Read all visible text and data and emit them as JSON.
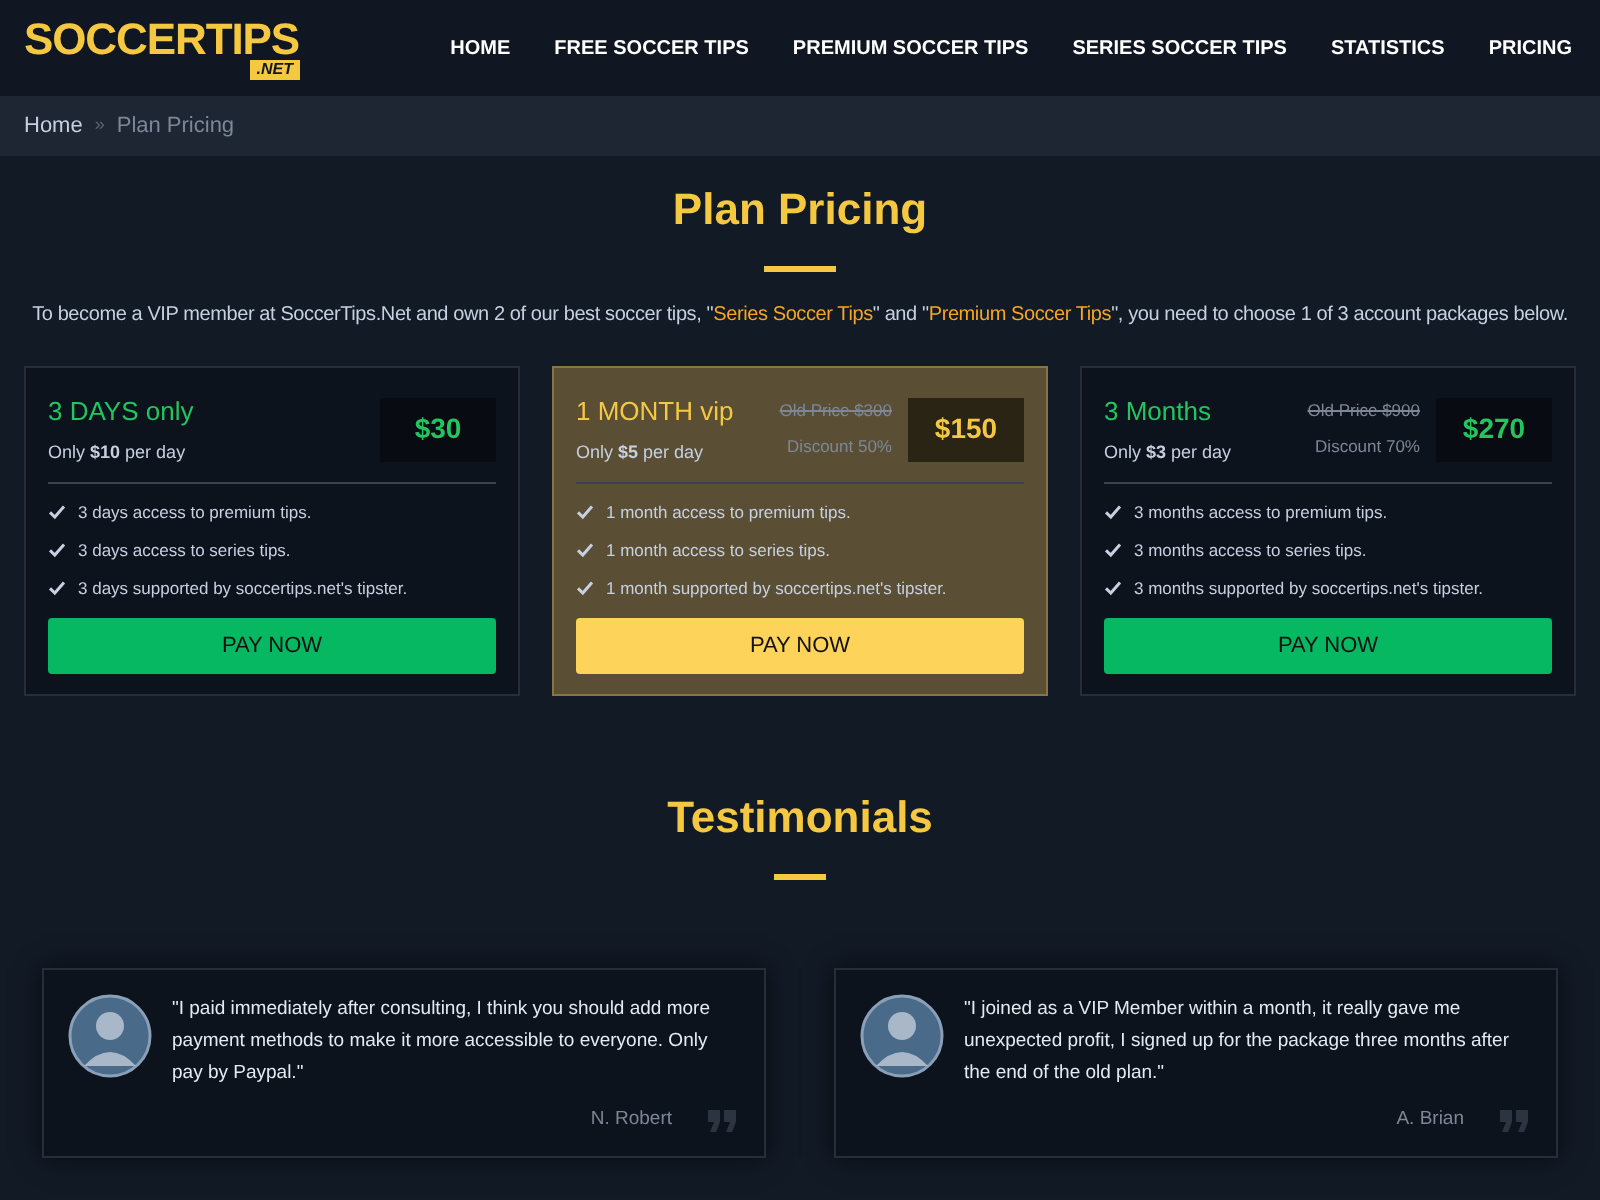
{
  "logo": {
    "name": "SOCCERTIPS",
    "suffix": ".NET"
  },
  "nav": [
    {
      "label": "HOME"
    },
    {
      "label": "FREE SOCCER TIPS"
    },
    {
      "label": "PREMIUM SOCCER TIPS"
    },
    {
      "label": "SERIES SOCCER TIPS"
    },
    {
      "label": "STATISTICS"
    },
    {
      "label": "PRICING"
    }
  ],
  "breadcrumb": {
    "home": "Home",
    "separator": "»",
    "current": "Plan Pricing"
  },
  "title": "Plan Pricing",
  "intro": [
    {
      "text": "To become a VIP member at SoccerTips.Net and own 2 of our best soccer tips, \"",
      "highlight": false
    },
    {
      "text": "Series Soccer Tips",
      "highlight": true
    },
    {
      "text": "\" and \"",
      "highlight": false
    },
    {
      "text": "Premium Soccer Tips",
      "highlight": true
    },
    {
      "text": "\", you need to choose 1 of 3 account packages below.",
      "highlight": false
    }
  ],
  "plans": [
    {
      "name": "3 DAYS only",
      "per_day": "Only **$10** per day",
      "price": "$30",
      "featured": false,
      "features": [
        "3 days access to premium tips.",
        "3 days access to series tips.",
        "3 days supported by soccertips.net's tipster."
      ],
      "button": "PAY NOW"
    },
    {
      "name": "1 MONTH vip",
      "per_day": "Only **$5** per day",
      "old_price": "Old Price $300",
      "discount": "Discount 50%",
      "price": "$150",
      "featured": true,
      "features": [
        "1 month access to premium tips.",
        "1 month access to series tips.",
        "1 month supported by soccertips.net's tipster."
      ],
      "button": "PAY NOW"
    },
    {
      "name": "3 Months",
      "per_day": "Only **$3** per day",
      "old_price": "Old Price $900",
      "discount": "Discount 70%",
      "price": "$270",
      "featured": false,
      "features": [
        "3 months access to premium tips.",
        "3 months access to series tips.",
        "3 months supported by soccertips.net's tipster."
      ],
      "button": "PAY NOW"
    }
  ],
  "testimonials_title": "Testimonials",
  "testimonials": [
    {
      "quote": "\"I paid immediately after consulting, I think you should add more payment methods to make it more accessible to everyone. Only pay by Paypal.\"",
      "author": "N. Robert"
    },
    {
      "quote": "\"I joined as a VIP Member within a month, it really gave me unexpected profit, I signed up for the package three months after the end of the old plan.\"",
      "author": "A. Brian"
    }
  ]
}
